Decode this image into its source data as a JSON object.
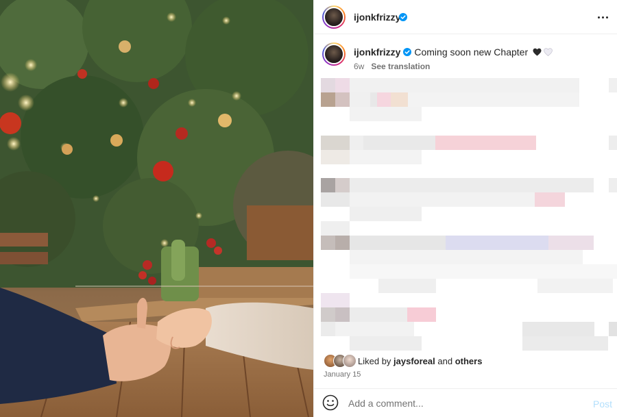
{
  "post": {
    "username": "ijonkfrizzy",
    "caption_text": "Coming soon new Chapter",
    "age": "6w",
    "see_translation": "See translation",
    "liked_by_prefix": "Liked by",
    "liked_by_user": "jaysforeal",
    "liked_by_and": "and",
    "liked_by_others": "others",
    "date": "January 15"
  },
  "comment": {
    "placeholder": "Add a comment...",
    "post_label": "Post"
  },
  "icons": {
    "verified": "verified-badge-icon",
    "more": "more-options-icon",
    "emoji": "emoji-icon",
    "hearts": [
      "black-heart-icon",
      "white-heart-icon"
    ]
  },
  "colors": {
    "verified_blue": "#0095f6",
    "post_disabled": "#b2dffc",
    "secondary_text": "#737373"
  }
}
